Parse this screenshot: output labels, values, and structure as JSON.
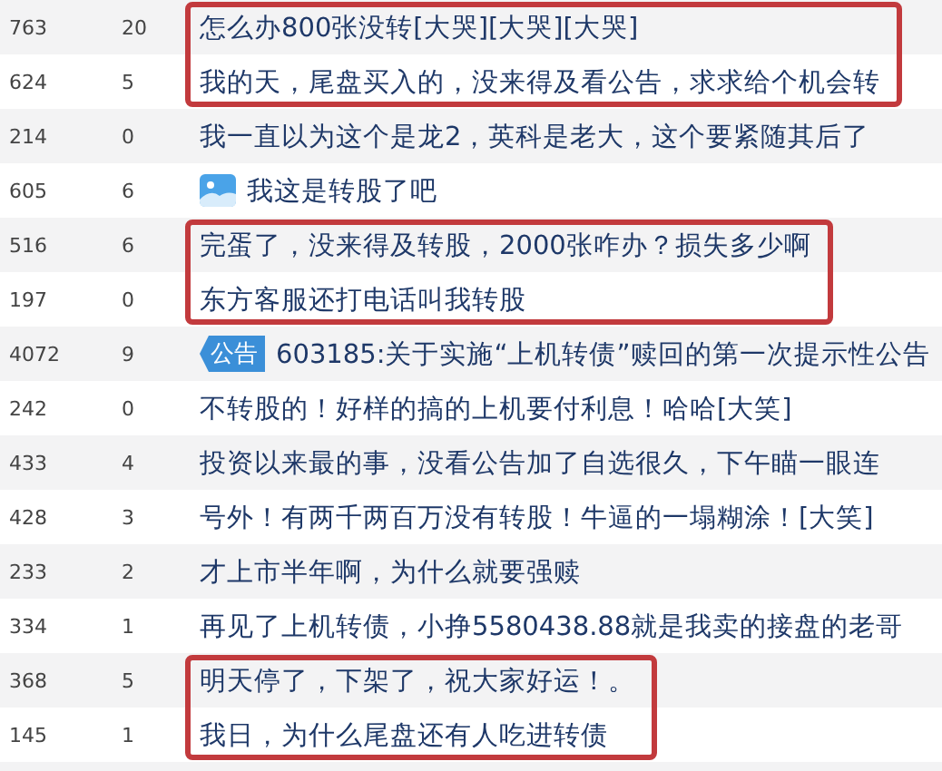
{
  "blocks": [
    {
      "boxed": true,
      "rows": [
        {
          "kind": "text",
          "reads": "763",
          "replies": "20",
          "title": "怎么办800张没转[大哭][大哭][大哭]"
        },
        {
          "kind": "text",
          "reads": "624",
          "replies": "5",
          "title": "我的天，尾盘买入的，没来得及看公告，求求给个机会转"
        }
      ]
    },
    {
      "boxed": false,
      "rows": [
        {
          "kind": "text",
          "reads": "214",
          "replies": "0",
          "title": "我一直以为这个是龙2，英科是老大，这个要紧随其后了"
        },
        {
          "kind": "image",
          "reads": "605",
          "replies": "6",
          "title": "我这是转股了吧"
        }
      ]
    },
    {
      "boxed": true,
      "rows": [
        {
          "kind": "text",
          "reads": "516",
          "replies": "6",
          "title": "完蛋了，没来得及转股，2000张咋办？损失多少啊"
        },
        {
          "kind": "text",
          "reads": "197",
          "replies": "0",
          "title": "东方客服还打电话叫我转股"
        }
      ]
    },
    {
      "boxed": false,
      "rows": [
        {
          "kind": "notice",
          "badge": "公告",
          "reads": "4072",
          "replies": "9",
          "title": "603185:关于实施“上机转债”赎回的第一次提示性公告"
        },
        {
          "kind": "text",
          "reads": "242",
          "replies": "0",
          "title": "不转股的！好样的搞的上机要付利息！哈哈[大笑]"
        },
        {
          "kind": "text",
          "reads": "433",
          "replies": "4",
          "title": "投资以来最的事，没看公告加了自选很久，下午瞄一眼连"
        },
        {
          "kind": "text",
          "reads": "428",
          "replies": "3",
          "title": "号外！有两千两百万没有转股！牛逼的一塌糊涂！[大笑]"
        },
        {
          "kind": "text",
          "reads": "233",
          "replies": "2",
          "title": "才上市半年啊，为什么就要强赎"
        },
        {
          "kind": "text",
          "reads": "334",
          "replies": "1",
          "title": "再见了上机转债，小挣5580438.88就是我卖的接盘的老哥"
        }
      ]
    },
    {
      "boxed": true,
      "rows": [
        {
          "kind": "text",
          "reads": "368",
          "replies": "5",
          "title": "明天停了，下架了，祝大家好运！。"
        },
        {
          "kind": "text",
          "reads": "145",
          "replies": "1",
          "title": "我日，为什么尾盘还有人吃进转债"
        }
      ]
    }
  ]
}
